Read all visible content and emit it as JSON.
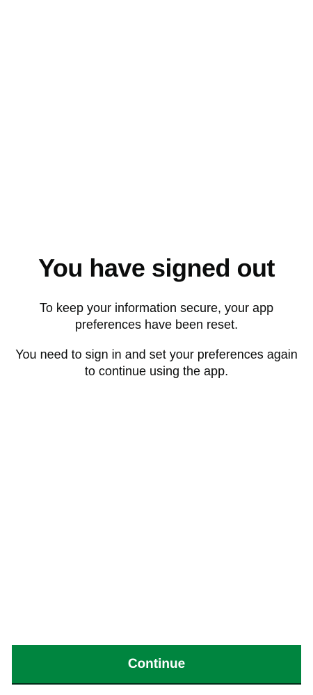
{
  "screen": {
    "title": "You have signed out",
    "paragraph_1": "To keep your information secure, your app preferences have been reset.",
    "paragraph_2": "You need to sign in and set your preferences again to continue using the app."
  },
  "actions": {
    "continue_label": "Continue"
  },
  "colors": {
    "background": "#ffffff",
    "text": "#0b0c0c",
    "primary_button": "#00853f",
    "primary_button_text": "#ffffff"
  }
}
